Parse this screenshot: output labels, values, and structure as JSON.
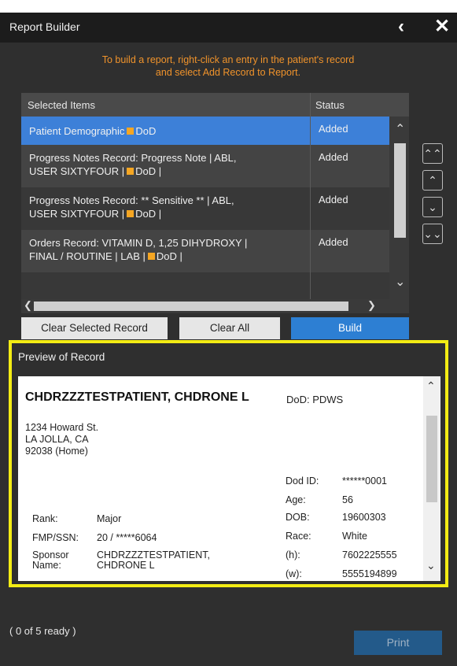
{
  "window": {
    "title": "Report Builder",
    "back_glyph": "‹",
    "close_glyph": "✕"
  },
  "instructions": {
    "line1": "To build a report, right-click an entry in the patient's record",
    "line2": "and select Add Record to Report."
  },
  "grid": {
    "headers": {
      "items": "Selected Items",
      "status": "Status"
    },
    "rows": [
      {
        "line1_a": "Patient Demographic",
        "line1_b": "DoD",
        "status": "Added",
        "selected": true
      },
      {
        "line1": "Progress Notes Record:  Progress Note  |  ABL,",
        "line2_a": "USER SIXTYFOUR  |",
        "line2_b": "DoD  |",
        "status": "Added"
      },
      {
        "line1": "Progress Notes Record:  ** Sensitive **  |  ABL,",
        "line2_a": "USER SIXTYFOUR  |",
        "line2_b": "DoD  |",
        "status": "Added"
      },
      {
        "line1": "Orders Record:  VITAMIN D, 1,25 DIHYDROXY  |",
        "line2_a": "FINAL / ROUTINE  |  LAB  |",
        "line2_b": "DoD  |",
        "status": "Added"
      }
    ],
    "scroll_glyphs": {
      "up": "⌃",
      "down": "⌄",
      "left": "❮",
      "right": "❯"
    }
  },
  "reorder": {
    "top": "⌃⌃",
    "up": "⌃",
    "down": "⌄",
    "bottom": "⌄⌄"
  },
  "buttons": {
    "clear_selected": "Clear Selected Record",
    "clear_all": "Clear All",
    "build": "Build",
    "print": "Print"
  },
  "preview": {
    "label": "Preview of Record",
    "name": "CHDRZZZTESTPATIENT, CHDRONE L",
    "source": "DoD: PDWS",
    "address": [
      "1234 Howard St.",
      "LA JOLLA, CA",
      "92038 (Home)"
    ],
    "rank_label": "Rank:",
    "rank": "Major",
    "fmp_label": "FMP/SSN:",
    "fmp": "20 / *****6064",
    "sponsor_label1": "Sponsor",
    "sponsor_label2": "Name:",
    "sponsor1": "CHDRZZZTESTPATIENT,",
    "sponsor2": "CHDRONE L",
    "dodid_label": "Dod ID:",
    "dodid": "******0001",
    "age_label": "Age:",
    "age": "56",
    "dob_label": "DOB:",
    "dob": "19600303",
    "race_label": "Race:",
    "race": "White",
    "h_label": "(h):",
    "h": "7602225555",
    "w_label": "(w):",
    "w": "5555194899"
  },
  "status_text": "( 0 of 5 ready )",
  "colors": {
    "accent": "#f0932b",
    "selected_row": "#3d80d8",
    "highlight_border": "#f3ec14",
    "dod_square": "#f5a623"
  }
}
